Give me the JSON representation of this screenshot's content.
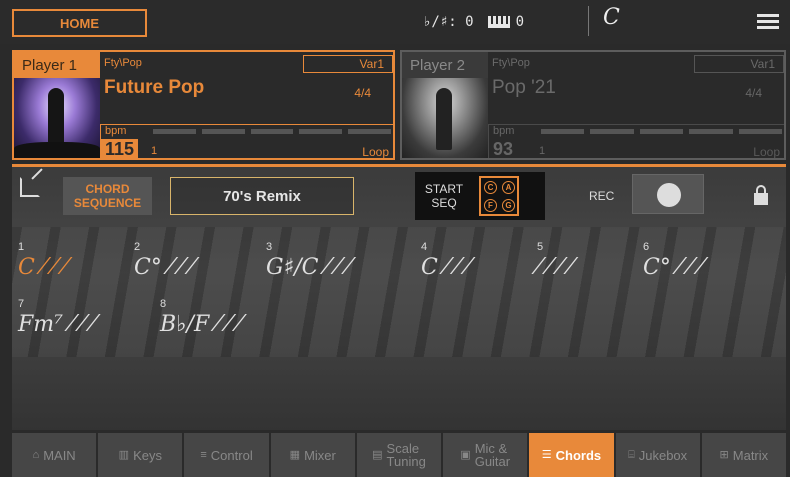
{
  "topbar": {
    "home_label": "HOME",
    "transpose_label": "♭/♯: 0",
    "octave_value": "0",
    "key_symbol": "C"
  },
  "players": [
    {
      "name": "Player 1",
      "category": "Fty\\Pop",
      "variation": "Var1",
      "title": "Future Pop",
      "meter": "4/4",
      "bpm_label": "bpm",
      "bpm": "115",
      "bar": "1",
      "mode": "Loop"
    },
    {
      "name": "Player 2",
      "category": "Fty\\Pop",
      "variation": "Var1",
      "title": "Pop '21",
      "meter": "4/4",
      "bpm_label": "bpm",
      "bpm": "93",
      "bar": "1",
      "mode": "Loop"
    }
  ],
  "chord_panel": {
    "chord_seq_label_1": "CHORD",
    "chord_seq_label_2": "SEQUENCE",
    "sequence_name": "70's Remix",
    "start_seq_1": "START",
    "start_seq_2": "SEQ",
    "rec_label": "REC"
  },
  "measures": [
    {
      "num": "1",
      "chord": "C  ⁄ ⁄ ⁄",
      "active": true
    },
    {
      "num": "2",
      "chord": "C°  ⁄ ⁄ ⁄"
    },
    {
      "num": "3",
      "chord": "G♯/C  ⁄ ⁄ ⁄"
    },
    {
      "num": "4",
      "chord": "C  ⁄ ⁄ ⁄"
    },
    {
      "num": "5",
      "chord": "⁄ ⁄ ⁄ ⁄"
    },
    {
      "num": "6",
      "chord": "C°  ⁄ ⁄ ⁄"
    },
    {
      "num": "7",
      "chord": "Fm⁷  ⁄ ⁄ ⁄"
    },
    {
      "num": "8",
      "chord": "B♭/F  ⁄ ⁄ ⁄"
    }
  ],
  "tabs": [
    {
      "label": "MAIN",
      "icon": "home-icon",
      "glyph": "⌂"
    },
    {
      "label": "Keys",
      "icon": "keys-icon",
      "glyph": "▥"
    },
    {
      "label": "Control",
      "icon": "control-icon",
      "glyph": "≡"
    },
    {
      "label": "Mixer",
      "icon": "mixer-icon",
      "glyph": "▦"
    },
    {
      "label": "Scale\nTuning",
      "icon": "scale-icon",
      "glyph": "▤"
    },
    {
      "label": "Mic &\nGuitar",
      "icon": "mic-icon",
      "glyph": "▣"
    },
    {
      "label": "Chords",
      "icon": "chords-icon",
      "glyph": "☰",
      "active": true
    },
    {
      "label": "Jukebox",
      "icon": "jukebox-icon",
      "glyph": "⌸"
    },
    {
      "label": "Matrix",
      "icon": "matrix-icon",
      "glyph": "⊞"
    }
  ],
  "colors": {
    "accent": "#e8893a",
    "background": "#2a2a2a"
  }
}
